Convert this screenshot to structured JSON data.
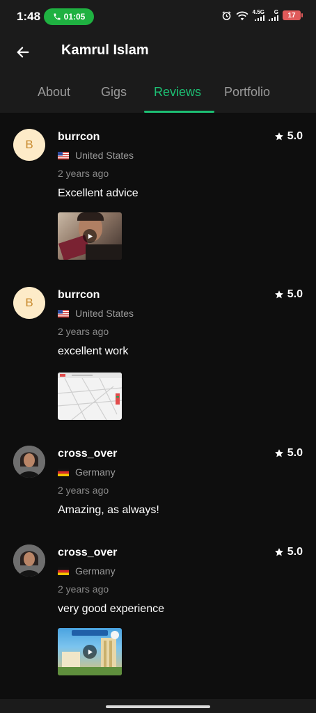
{
  "status_bar": {
    "time": "1:48",
    "call_duration": "01:05",
    "network_4g": "4.5G",
    "network_g": "G",
    "battery": "17"
  },
  "header": {
    "title": "Kamrul Islam",
    "tabs": [
      {
        "label": "About"
      },
      {
        "label": "Gigs"
      },
      {
        "label": "Reviews",
        "active": true
      },
      {
        "label": "Portfolio"
      }
    ]
  },
  "colors": {
    "accent": "#1dbf73",
    "background": "#0e0e0e",
    "surface": "#1b1b1b"
  },
  "reviews": [
    {
      "avatar_letter": "B",
      "username": "burrcon",
      "rating": "5.0",
      "country": "United States",
      "time_ago": "2 years ago",
      "comment": "Excellent advice",
      "attachment": "video-thumbnail"
    },
    {
      "avatar_letter": "B",
      "username": "burrcon",
      "rating": "5.0",
      "country": "United States",
      "time_ago": "2 years ago",
      "comment": "excellent work",
      "attachment": "image-thumbnail"
    },
    {
      "avatar_letter": "",
      "username": "cross_over",
      "rating": "5.0",
      "country": "Germany",
      "time_ago": "2 years ago",
      "comment": "Amazing, as always!",
      "attachment": ""
    },
    {
      "avatar_letter": "",
      "username": "cross_over",
      "rating": "5.0",
      "country": "Germany",
      "time_ago": "2 years ago",
      "comment": "very good experience",
      "attachment": "video-thumbnail"
    }
  ]
}
